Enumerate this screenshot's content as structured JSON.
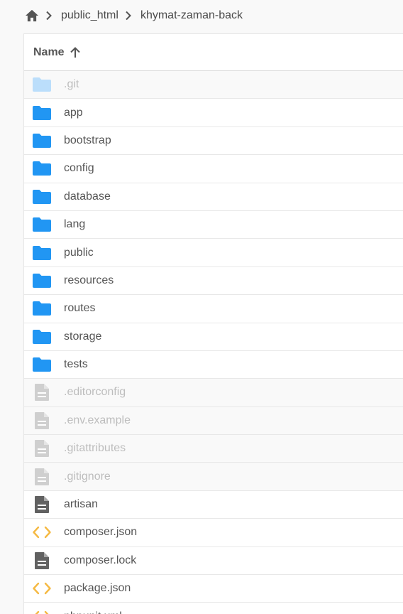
{
  "breadcrumb": {
    "home_icon": "home-icon",
    "items": [
      {
        "label": "public_html"
      },
      {
        "label": "khymat-zaman-back"
      }
    ]
  },
  "listing": {
    "header": {
      "name_label": "Name",
      "sort_icon": "arrow-up-icon",
      "sort_direction": "ascending"
    },
    "items": [
      {
        "name": ".git",
        "type": "folder",
        "hidden": true
      },
      {
        "name": "app",
        "type": "folder",
        "hidden": false
      },
      {
        "name": "bootstrap",
        "type": "folder",
        "hidden": false
      },
      {
        "name": "config",
        "type": "folder",
        "hidden": false
      },
      {
        "name": "database",
        "type": "folder",
        "hidden": false
      },
      {
        "name": "lang",
        "type": "folder",
        "hidden": false
      },
      {
        "name": "public",
        "type": "folder",
        "hidden": false
      },
      {
        "name": "resources",
        "type": "folder",
        "hidden": false
      },
      {
        "name": "routes",
        "type": "folder",
        "hidden": false
      },
      {
        "name": "storage",
        "type": "folder",
        "hidden": false
      },
      {
        "name": "tests",
        "type": "folder",
        "hidden": false
      },
      {
        "name": ".editorconfig",
        "type": "file",
        "hidden": true
      },
      {
        "name": ".env.example",
        "type": "file",
        "hidden": true
      },
      {
        "name": ".gitattributes",
        "type": "file",
        "hidden": true
      },
      {
        "name": ".gitignore",
        "type": "file",
        "hidden": true
      },
      {
        "name": "artisan",
        "type": "file",
        "hidden": false
      },
      {
        "name": "composer.json",
        "type": "code",
        "hidden": false
      },
      {
        "name": "composer.lock",
        "type": "file",
        "hidden": false
      },
      {
        "name": "package.json",
        "type": "code",
        "hidden": false
      },
      {
        "name": "phpunit.xml",
        "type": "code",
        "hidden": false
      }
    ]
  },
  "colors": {
    "folder": "#2196f3",
    "folder_hidden": "#bbdefb",
    "file": "#616161",
    "file_hidden": "#cfcfcf",
    "code": "#f5b942",
    "text": "#555555",
    "text_hidden": "#bdbdbd"
  }
}
